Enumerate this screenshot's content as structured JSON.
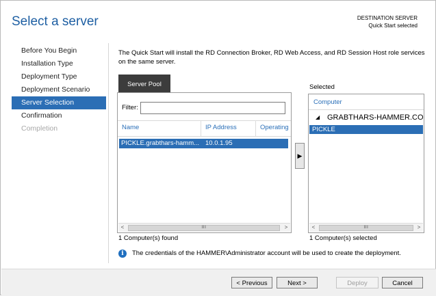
{
  "window": {
    "title": "Select a server",
    "destination_label": "DESTINATION SERVER",
    "destination_value": "Quick Start selected"
  },
  "nav": {
    "items": [
      {
        "label": "Before You Begin",
        "state": "normal"
      },
      {
        "label": "Installation Type",
        "state": "normal"
      },
      {
        "label": "Deployment Type",
        "state": "normal"
      },
      {
        "label": "Deployment Scenario",
        "state": "normal"
      },
      {
        "label": "Server Selection",
        "state": "active"
      },
      {
        "label": "Confirmation",
        "state": "normal"
      },
      {
        "label": "Completion",
        "state": "disabled"
      }
    ]
  },
  "intro_text": "The Quick Start will install the RD Connection Broker, RD Web Access, and RD Session Host role services on the same server.",
  "pool": {
    "tab_label": "Server Pool",
    "filter_label": "Filter:",
    "filter_value": "",
    "columns": [
      "Name",
      "IP Address",
      "Operating"
    ],
    "rows": [
      {
        "name": "PICKLE.grabthars-hamm...",
        "ip": "10.0.1.95"
      }
    ],
    "found_text": "1 Computer(s) found"
  },
  "add_button_glyph": "▶",
  "selected": {
    "label": "Selected",
    "column": "Computer",
    "group": "GRABTHARS-HAMMER.COM",
    "group_glyph": "◢",
    "rows": [
      "PICKLE"
    ],
    "count_text": "1 Computer(s) selected"
  },
  "scrollbar": {
    "left": "<",
    "right": ">",
    "thumb": "III"
  },
  "info": {
    "icon": "i",
    "text": "The credentials of the HAMMER\\Administrator account will be used to create the deployment."
  },
  "footer": {
    "previous": "< Previous",
    "next": "Next >",
    "deploy": "Deploy",
    "cancel": "Cancel"
  },
  "colors": {
    "accent": "#2b6eb5",
    "title": "#1e5fa3",
    "header_link": "#2a6fb8"
  }
}
